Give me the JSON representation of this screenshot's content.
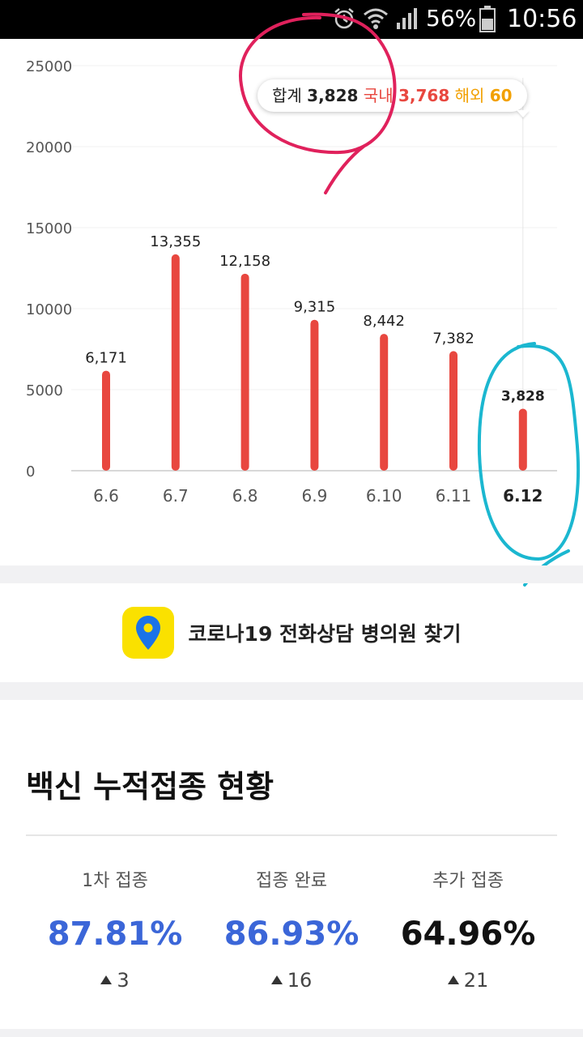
{
  "status_bar": {
    "battery_pct": "56%",
    "time": "10:56",
    "icons": [
      "alarm-icon",
      "wifi-icon",
      "signal-icon",
      "battery-icon"
    ]
  },
  "chart_data": {
    "type": "bar",
    "categories": [
      "6.6",
      "6.7",
      "6.8",
      "6.9",
      "6.10",
      "6.11",
      "6.12"
    ],
    "values": [
      6171,
      13355,
      12158,
      9315,
      8442,
      7382,
      3828
    ],
    "value_labels": [
      "6,171",
      "13,355",
      "12,158",
      "9,315",
      "8,442",
      "7,382",
      "3,828"
    ],
    "y_ticks": [
      "0",
      "5000",
      "10000",
      "15000",
      "20000",
      "25000"
    ],
    "ylim": [
      0,
      25000
    ],
    "highlight_index": 6,
    "bar_color": "#e8473f",
    "grid": true
  },
  "tooltip": {
    "total_label": "합계",
    "total_value": "3,828",
    "domestic_label": "국내",
    "domestic_value": "3,768",
    "overseas_label": "해외",
    "overseas_value": "60",
    "colors": {
      "domestic": "#e8473f",
      "overseas": "#f2a000"
    }
  },
  "finder": {
    "label": "코로나19 전화상담 병의원 찾기",
    "icon": "map-pin-icon",
    "icon_bg": "#fae100",
    "pin_color": "#1a73e8"
  },
  "vaccine": {
    "title": "백신 누적접종 현황",
    "columns": [
      {
        "label": "1차 접종",
        "pct": "87.81%",
        "change": "3",
        "color": "#3b66d8"
      },
      {
        "label": "접종 완료",
        "pct": "86.93%",
        "change": "16",
        "color": "#3b66d8"
      },
      {
        "label": "추가 접종",
        "pct": "64.96%",
        "change": "21",
        "color": "#111111"
      }
    ]
  },
  "annotations": {
    "circle_colors": [
      "#e0215c",
      "#1bb7d0"
    ]
  }
}
